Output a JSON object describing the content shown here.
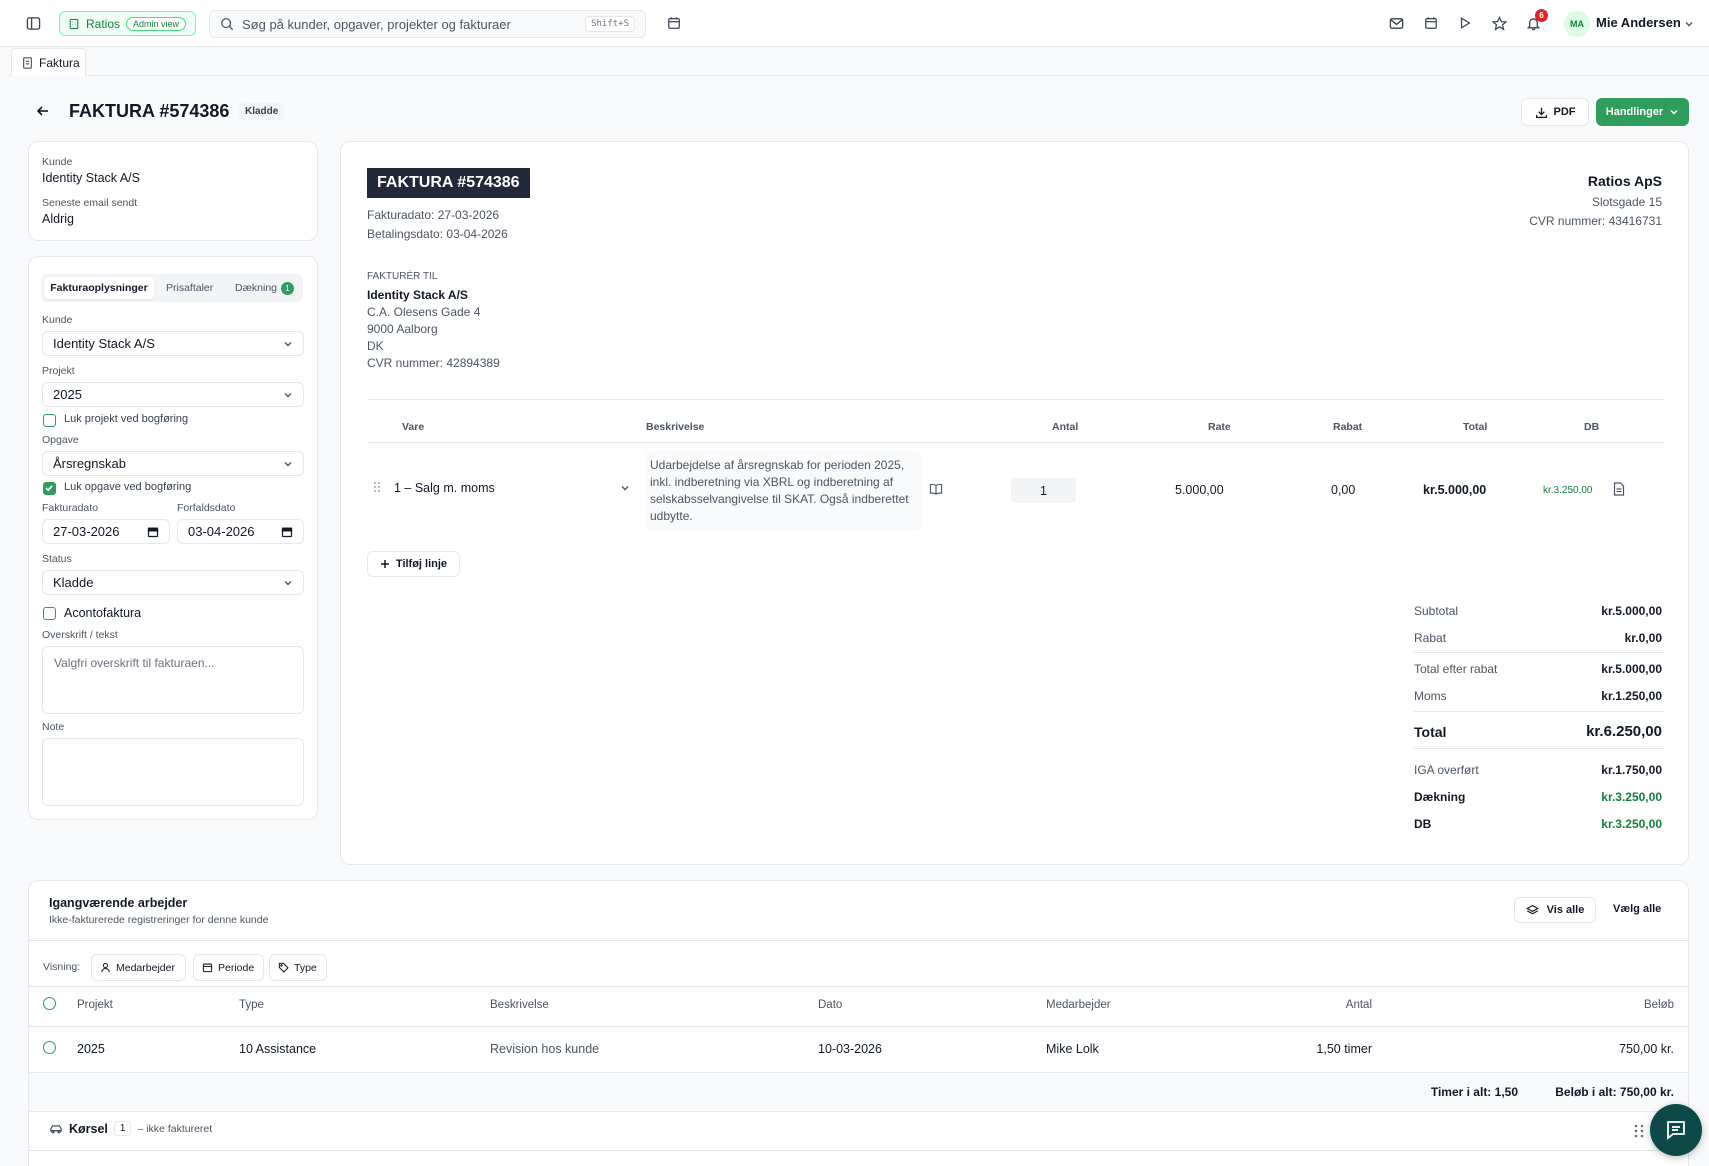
{
  "topbar": {
    "brand": "Ratios",
    "admin_badge": "Admin view",
    "search_placeholder": "Søg på kunder, opgaver, projekter og fakturaer",
    "search_shortcut": "Shift+S",
    "notification_count": "6",
    "user_initials": "MA",
    "user_name": "Mie Andersen"
  },
  "page_tab": "Faktura",
  "header": {
    "title": "FAKTURA #574386",
    "status_badge": "Kladde",
    "pdf_label": "PDF",
    "actions_label": "Handlinger"
  },
  "customer_card": {
    "customer_label": "Kunde",
    "customer_value": "Identity Stack A/S",
    "email_label": "Seneste email sendt",
    "email_value": "Aldrig"
  },
  "form": {
    "tabs": [
      "Fakturaoplysninger",
      "Prisaftaler",
      "Dækning"
    ],
    "coverage_count": "1",
    "kunde_label": "Kunde",
    "kunde_value": "Identity Stack A/S",
    "projekt_label": "Projekt",
    "projekt_value": "2025",
    "close_project_label": "Luk projekt ved bogføring",
    "opgave_label": "Opgave",
    "opgave_value": "Årsregnskab",
    "close_task_label": "Luk opgave ved bogføring",
    "invoice_date_label": "Fakturadato",
    "invoice_date_value": "27-03-2026",
    "due_date_label": "Forfaldsdato",
    "due_date_value": "03-04-2026",
    "status_label": "Status",
    "status_value": "Kladde",
    "aconto_label": "Acontofaktura",
    "heading_label": "Overskrift / tekst",
    "heading_placeholder": "Valgfri overskrift til fakturaen...",
    "note_label": "Note"
  },
  "invoice": {
    "title": "FAKTURA #574386",
    "invoice_date": "Fakturadato: 27-03-2026",
    "payment_date": "Betalingsdato: 03-04-2026",
    "company_name": "Ratios ApS",
    "company_address": "Slotsgade 15",
    "company_cvr": "CVR nummer: 43416731",
    "bill_to_label": "FAKTURÉR TIL",
    "bill_to_name": "Identity Stack A/S",
    "bill_to_lines": [
      "C.A. Olesens Gade 4",
      "9000 Aalborg",
      "DK",
      "CVR nummer: 42894389"
    ],
    "columns": [
      "Vare",
      "Beskrivelse",
      "Antal",
      "Rate",
      "Rabat",
      "Total",
      "DB"
    ],
    "line": {
      "item": "1 – Salg m. moms",
      "description": "Udarbejdelse af årsregnskab for perioden 2025, inkl. indberetning via XBRL og indberetning af selskabsselvangivelse til SKAT. Også indberettet udbytte.",
      "qty": "1",
      "rate": "5.000,00",
      "discount": "0,00",
      "total": "kr.5.000,00",
      "db": "kr.3.250,00"
    },
    "add_line_label": "Tilføj linje",
    "summary": {
      "subtotal_label": "Subtotal",
      "subtotal": "kr.5.000,00",
      "discount_label": "Rabat",
      "discount": "kr.0,00",
      "after_discount_label": "Total efter rabat",
      "after_discount": "kr.5.000,00",
      "vat_label": "Moms",
      "vat": "kr.1.250,00",
      "total_label": "Total",
      "total": "kr.6.250,00",
      "iga_label": "IGA overført",
      "iga": "kr.1.750,00",
      "coverage_label": "Dækning",
      "coverage": "kr.3.250,00",
      "db_label": "DB",
      "db": "kr.3.250,00"
    }
  },
  "ongoing": {
    "title": "Igangværende arbejder",
    "subtitle": "Ikke-fakturerede registreringer for denne kunde",
    "show_all": "Vis alle",
    "select_all": "Vælg alle",
    "view_label": "Visning:",
    "chips": [
      "Medarbejder",
      "Periode",
      "Type"
    ],
    "columns": [
      "Projekt",
      "Type",
      "Beskrivelse",
      "Dato",
      "Medarbejder",
      "Antal",
      "Beløb"
    ],
    "rows": [
      {
        "projekt": "2025",
        "type": "10 Assistance",
        "beskrivelse": "Revision hos kunde",
        "dato": "10-03-2026",
        "medarbejder": "Mike Lolk",
        "antal": "1,50 timer",
        "belob": "750,00 kr."
      }
    ],
    "total_hours": "Timer i alt: 1,50",
    "total_amount": "Beløb i alt: 750,00 kr.",
    "mileage_label": "Kørsel",
    "mileage_count": "1",
    "mileage_status": "– ikke faktureret"
  }
}
